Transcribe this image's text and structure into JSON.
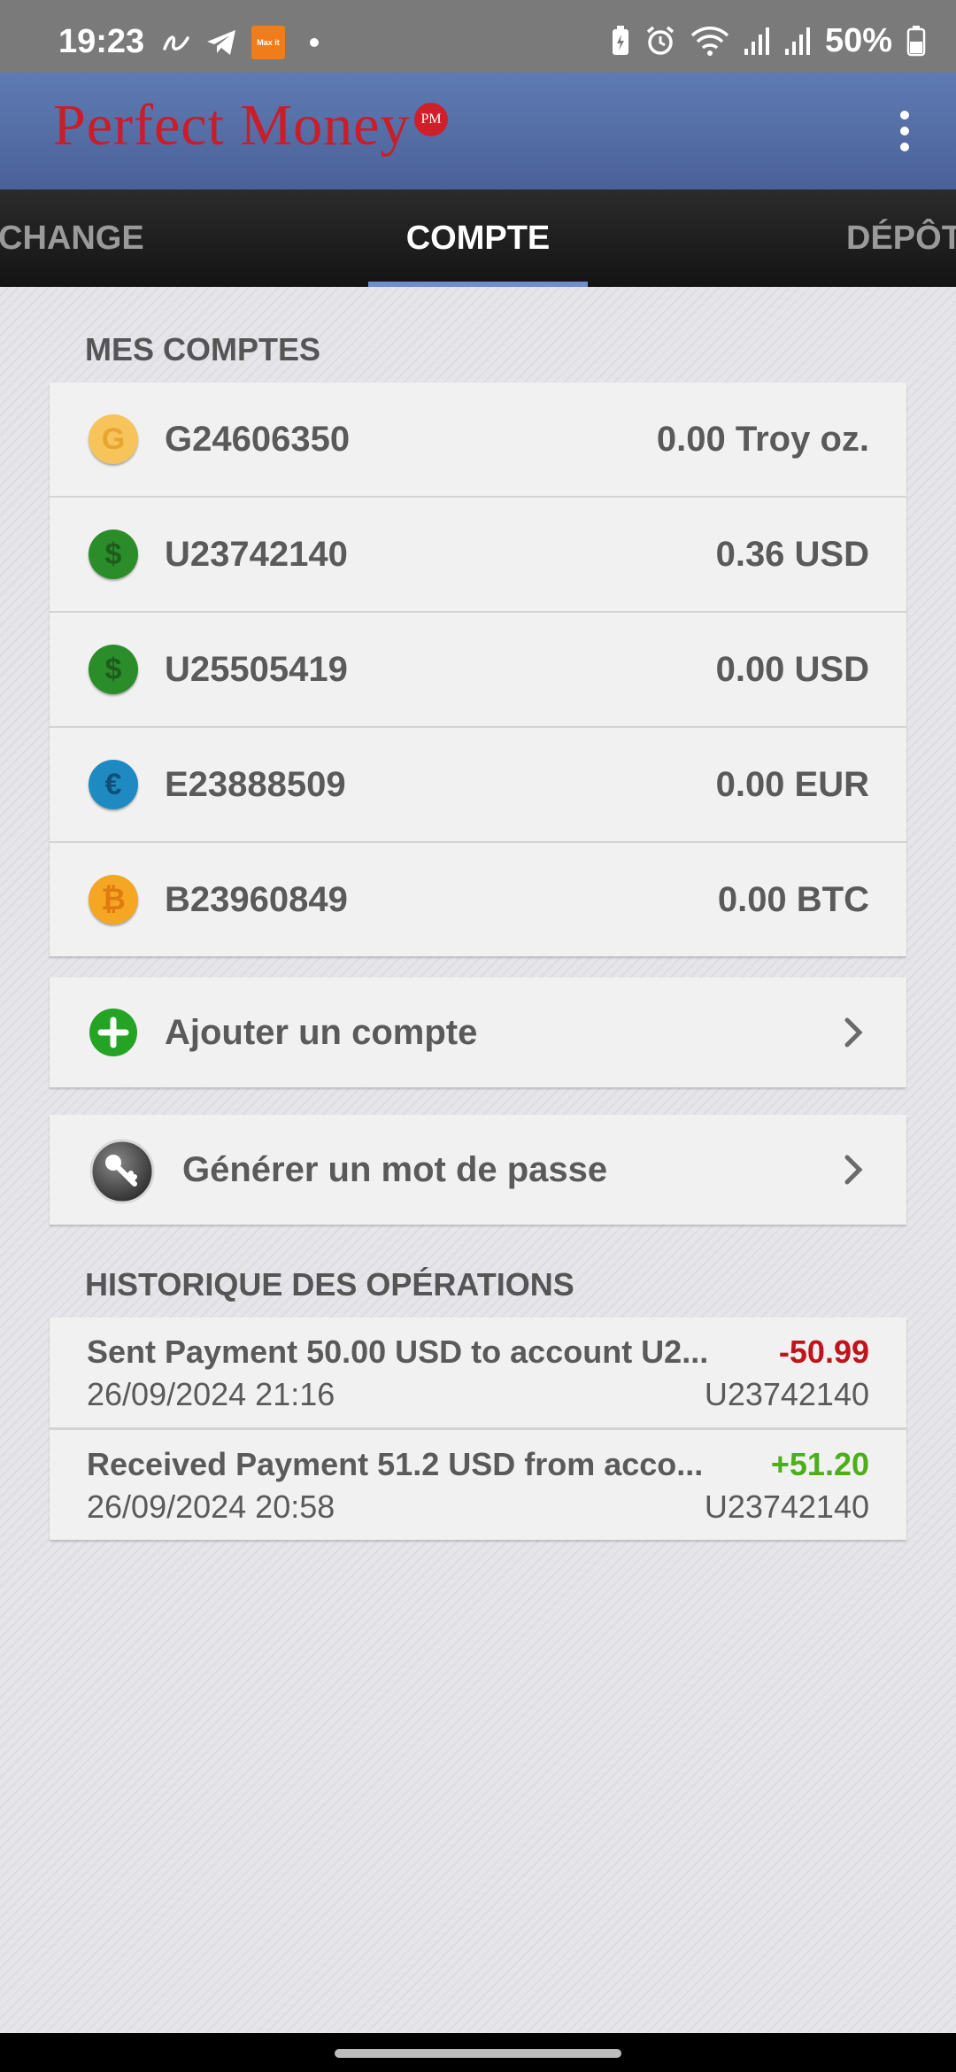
{
  "status_bar": {
    "time": "19:23",
    "battery": "50%",
    "left_icons": [
      "link-icon",
      "telegram-icon",
      "max-it-app-icon",
      "dot-icon"
    ],
    "right_icons": [
      "battery-saver-icon",
      "alarm-icon",
      "wifi-icon",
      "signal-icon",
      "signal-icon",
      "battery-icon"
    ],
    "app_badge_text": "Max it"
  },
  "header": {
    "logo_text": "Perfect Money",
    "logo_badge": "PM",
    "menu_icon": "overflow-menu-icon"
  },
  "tabs": [
    {
      "label": "CHANGE",
      "active": false
    },
    {
      "label": "COMPTE",
      "active": true
    },
    {
      "label": "DÉPÔT",
      "active": false
    }
  ],
  "accounts_section": {
    "title": "MES COMPTES",
    "accounts": [
      {
        "id": "G24606350",
        "balance": "0.00 Troy oz.",
        "icon": "gold-coin-icon",
        "symbol": "G",
        "color": "#f2b33a",
        "text_color": "#e8a531"
      },
      {
        "id": "U23742140",
        "balance": "0.36 USD",
        "icon": "dollar-coin-icon",
        "symbol": "$",
        "color": "#2a8d2a",
        "text_color": "#1e5c1e"
      },
      {
        "id": "U25505419",
        "balance": "0.00 USD",
        "icon": "dollar-coin-icon",
        "symbol": "$",
        "color": "#2a8d2a",
        "text_color": "#1e5c1e"
      },
      {
        "id": "E23888509",
        "balance": "0.00 EUR",
        "icon": "euro-coin-icon",
        "symbol": "€",
        "color": "#1f8ac2",
        "text_color": "#0f4f78"
      },
      {
        "id": "B23960849",
        "balance": "0.00 BTC",
        "icon": "bitcoin-coin-icon",
        "symbol": "₿",
        "color": "#f5a623",
        "text_color": "#e07b12"
      }
    ]
  },
  "actions": {
    "add_account": {
      "label": "Ajouter un compte",
      "icon": "add-circle-icon"
    },
    "generate_password": {
      "label": "Générer un mot de passe",
      "icon": "key-icon"
    }
  },
  "history_section": {
    "title": "HISTORIQUE DES OPÉRATIONS",
    "items": [
      {
        "description": "Sent Payment 50.00 USD to account U2...",
        "amount": "-50.99",
        "amount_color": "#c0141c",
        "date": "26/09/2024 21:16",
        "account": "U23742140"
      },
      {
        "description": "Received Payment 51.2 USD from acco...",
        "amount": "+51.20",
        "amount_color": "#4caf1a",
        "date": "26/09/2024 20:58",
        "account": "U23742140"
      }
    ]
  }
}
